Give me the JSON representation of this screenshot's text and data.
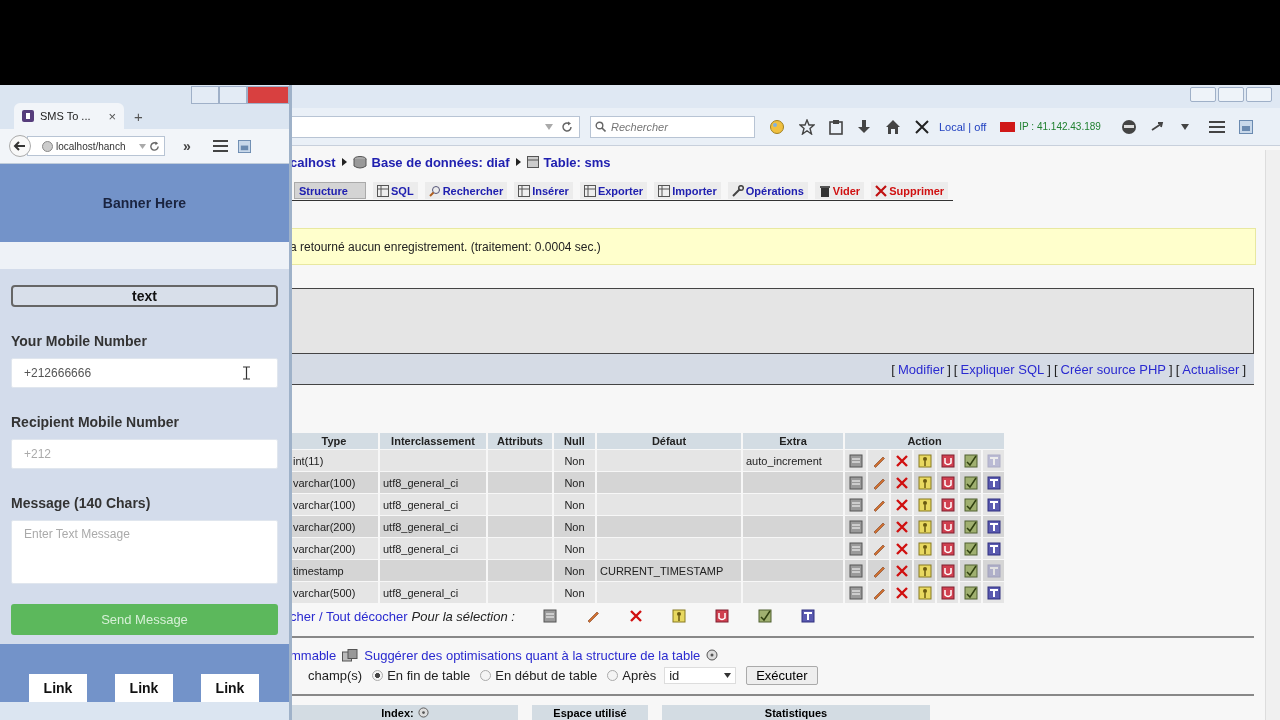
{
  "small_window": {
    "tab": {
      "title": "SMS To ...",
      "close": "×"
    },
    "new_tab": "+",
    "address": "localhost/hanch",
    "overflow": "»",
    "banner": "Banner Here",
    "text_button": "text",
    "fields": [
      {
        "kind": "input",
        "label": "Your Mobile Number",
        "value": "+212666666"
      },
      {
        "kind": "input",
        "label": "Recipient Mobile Number",
        "placeholder": "+212"
      },
      {
        "kind": "textarea",
        "label": "Message (140 Chars)",
        "placeholder": "Enter Text Message"
      }
    ],
    "send_button": "Send Message",
    "footer_links": [
      "Link",
      "Link",
      "Link"
    ]
  },
  "main_window": {
    "search": {
      "placeholder": "Rechercher"
    },
    "proxy_status": "Local | off",
    "ip": "IP : 41.142.43.189",
    "breadcrumb": [
      {
        "kind": "server",
        "label": "calhost"
      },
      {
        "kind": "database",
        "label": "Base de données: diaf"
      },
      {
        "kind": "table",
        "label": "Table: sms"
      }
    ],
    "tabs": [
      {
        "kind": "structure",
        "label": "Structure",
        "selected": true,
        "danger": false
      },
      {
        "kind": "sql",
        "label": "SQL",
        "selected": false,
        "danger": false
      },
      {
        "kind": "search",
        "label": "Rechercher",
        "selected": false,
        "danger": false
      },
      {
        "kind": "insert",
        "label": "Insérer",
        "selected": false,
        "danger": false
      },
      {
        "kind": "export",
        "label": "Exporter",
        "selected": false,
        "danger": false
      },
      {
        "kind": "import",
        "label": "Importer",
        "selected": false,
        "danger": false
      },
      {
        "kind": "operations",
        "label": "Opérations",
        "selected": false,
        "danger": false
      },
      {
        "kind": "empty",
        "label": "Vider",
        "selected": false,
        "danger": true
      },
      {
        "kind": "drop",
        "label": "Supprimer",
        "selected": false,
        "danger": true
      }
    ],
    "message": "a retourné aucun enregistrement. (traitement: 0.0004 sec.)",
    "query_links": [
      {
        "open": "[",
        "label": "Modifier",
        "close": "]"
      },
      {
        "open": "[",
        "label": "Expliquer SQL",
        "close": "]"
      },
      {
        "open": "[",
        "label": "Créer source PHP",
        "close": "]"
      },
      {
        "open": "[",
        "label": "Actualiser",
        "close": "]"
      }
    ],
    "table": {
      "columns": [
        "Type",
        "Interclassement",
        "Attributs",
        "Null",
        "Défaut",
        "Extra",
        "Action"
      ],
      "rows": [
        {
          "cells": [
            "int(11)",
            "",
            "",
            "Non",
            "",
            "auto_increment"
          ],
          "fulltext": false
        },
        {
          "cells": [
            "varchar(100)",
            "utf8_general_ci",
            "",
            "Non",
            "",
            ""
          ],
          "fulltext": true
        },
        {
          "cells": [
            "varchar(100)",
            "utf8_general_ci",
            "",
            "Non",
            "",
            ""
          ],
          "fulltext": true
        },
        {
          "cells": [
            "varchar(200)",
            "utf8_general_ci",
            "",
            "Non",
            "",
            ""
          ],
          "fulltext": true
        },
        {
          "cells": [
            "varchar(200)",
            "utf8_general_ci",
            "",
            "Non",
            "",
            ""
          ],
          "fulltext": true
        },
        {
          "cells": [
            "timestamp",
            "",
            "",
            "Non",
            "CURRENT_TIMESTAMP",
            ""
          ],
          "fulltext": false
        },
        {
          "cells": [
            "varchar(500)",
            "utf8_general_ci",
            "",
            "Non",
            "",
            ""
          ],
          "fulltext": true
        }
      ]
    },
    "selection": {
      "links": "cher / Tout décocher",
      "label": "Pour la sélection :"
    },
    "print_link": "mmable",
    "suggest_link": "Suggérer des optimisations quant à la structure de la table",
    "add_fields": {
      "label": "champ(s)",
      "positions": [
        {
          "label": "En fin de table",
          "selected": true
        },
        {
          "label": "En début de table",
          "selected": false
        },
        {
          "label": "Après",
          "selected": false
        }
      ],
      "after_select": "id",
      "button": "Exécuter"
    },
    "bottom_headers": [
      "Index:",
      "Espace utilisé",
      "Statistiques"
    ]
  }
}
